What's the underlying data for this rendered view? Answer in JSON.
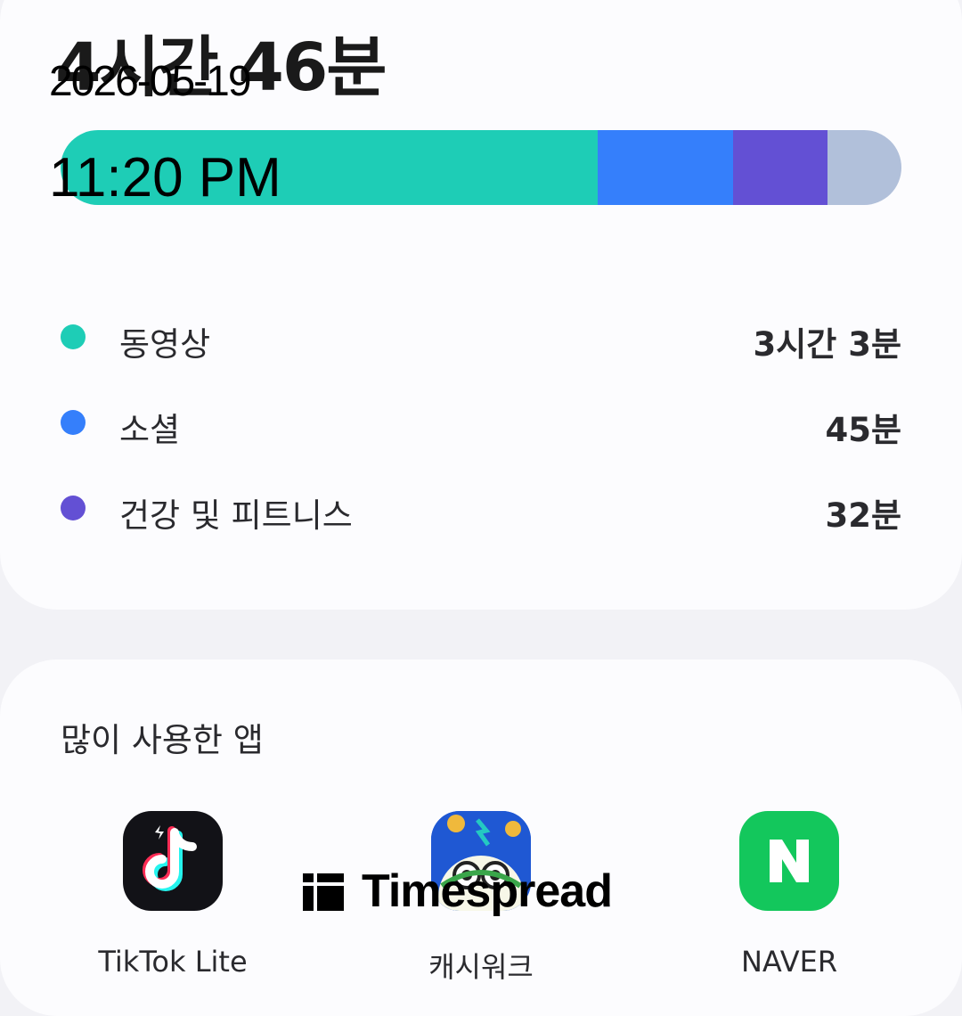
{
  "summary": {
    "total_time": "4시간 46분",
    "usage_bar": [
      {
        "category": "동영상",
        "color": "#1ecdb6",
        "fraction": 0.639
      },
      {
        "category": "소셜",
        "color": "#357ffb",
        "fraction": 0.161
      },
      {
        "category": "건강 및 피트니스",
        "color": "#6350d4",
        "fraction": 0.112
      },
      {
        "category": "기타",
        "color": "#b1c0da",
        "fraction": 0.088
      }
    ],
    "legend": [
      {
        "label": "동영상",
        "value": "3시간 3분",
        "color": "#1ecdb6"
      },
      {
        "label": "소셜",
        "value": "45분",
        "color": "#357ffb"
      },
      {
        "label": "건강 및 피트니스",
        "value": "32분",
        "color": "#6350d4"
      }
    ]
  },
  "overlay": {
    "date": "2026-05-19",
    "time": "11:20 PM"
  },
  "most_used": {
    "title": "많이 사용한 앱",
    "apps": [
      {
        "name": "TikTok Lite",
        "icon": "tiktok-icon"
      },
      {
        "name": "캐시워크",
        "icon": "cash-app-icon"
      },
      {
        "name": "NAVER",
        "icon": "naver-icon"
      }
    ]
  },
  "watermark": {
    "text": "Timespread"
  }
}
